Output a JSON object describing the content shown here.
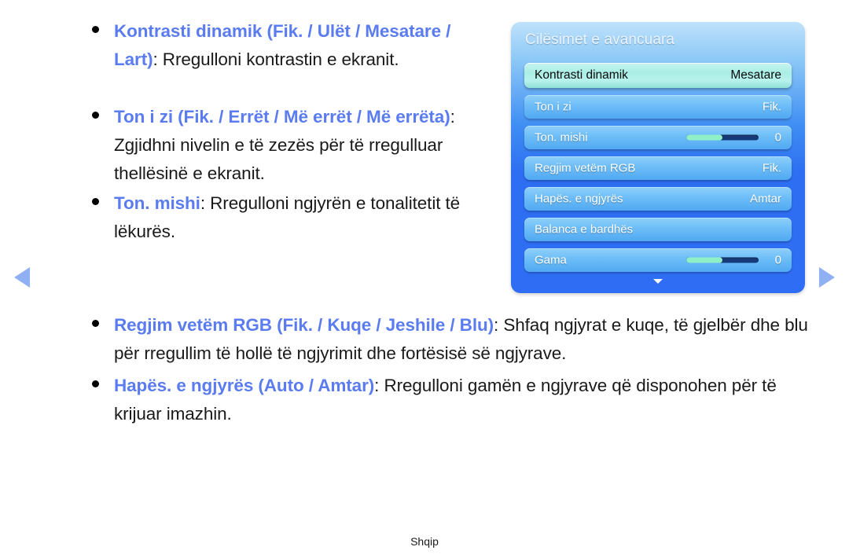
{
  "page": {
    "footer_label": "Shqip",
    "accent_term_color": "#5b7cf0",
    "body_text_color": "#1a1a1a",
    "nav_arrow_color": "#8fb0f2"
  },
  "nav": {
    "prev_label": "previous-page",
    "next_label": "next-page"
  },
  "doc": {
    "items": [
      {
        "term": "Kontrasti dinamik (Fik. / Ulët / Mesatare / Lart)",
        "description": ": Rregulloni kontrastin e ekranit."
      },
      {
        "term": "Ton i zi (Fik. / Errët / Më errët / Më errëta)",
        "description": ": Zgjidhni nivelin e të zezës për të rregulluar thellësinë e ekranit."
      },
      {
        "term": "Ton. mishi",
        "description": ": Rregulloni ngjyrën e tonalitetit të lëkurës."
      },
      {
        "term": "Regjim vetëm RGB (Fik. / Kuqe / Jeshile / Blu)",
        "description": ": Shfaq ngjyrat e kuqe, të gjelbër dhe blu për rregullim të hollë të ngjyrimit dhe fortësisë së ngjyrave."
      },
      {
        "term": "Hapës. e ngjyrës (Auto / Amtar)",
        "description": ": Rregulloni gamën e ngjyrave që disponohen për të krijuar imazhin."
      }
    ]
  },
  "osd": {
    "title": "Cilësimet e avancuara",
    "scroll_down_icon": "chevron-down-icon",
    "rows": [
      {
        "label": "Kontrasti dinamik",
        "value": "Mesatare",
        "selected": true,
        "type": "value"
      },
      {
        "label": "Ton i zi",
        "value": "Fik.",
        "selected": false,
        "type": "value"
      },
      {
        "label": "Ton. mishi",
        "value": "0",
        "selected": false,
        "type": "slider",
        "slider_percent": 50
      },
      {
        "label": "Regjim vetëm RGB",
        "value": "Fik.",
        "selected": false,
        "type": "value"
      },
      {
        "label": "Hapës. e ngjyrës",
        "value": "Amtar",
        "selected": false,
        "type": "value"
      },
      {
        "label": "Balanca e bardhës",
        "value": "",
        "selected": false,
        "type": "submenu"
      },
      {
        "label": "Gama",
        "value": "0",
        "selected": false,
        "type": "slider",
        "slider_percent": 50
      }
    ]
  }
}
